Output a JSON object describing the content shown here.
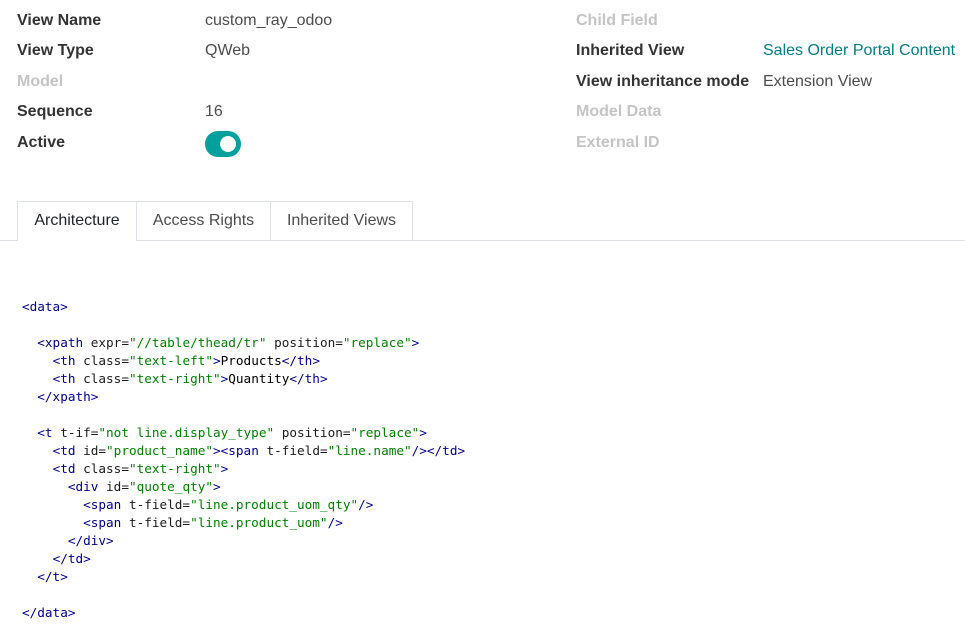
{
  "fields_left": [
    {
      "label": "View Name",
      "value": "custom_ray_odoo",
      "muted": false
    },
    {
      "label": "View Type",
      "value": "QWeb",
      "muted": false
    },
    {
      "label": "Model",
      "value": "",
      "muted": true
    },
    {
      "label": "Sequence",
      "value": "16",
      "muted": false
    },
    {
      "label": "Active",
      "toggle": true,
      "muted": false
    }
  ],
  "fields_right": [
    {
      "label": "Child Field",
      "value": "",
      "muted": true
    },
    {
      "label": "Inherited View",
      "value": "Sales Order Portal Content",
      "muted": false,
      "link": true
    },
    {
      "label": "View inheritance mode",
      "value": "Extension View",
      "muted": false
    },
    {
      "label": "Model Data",
      "value": "",
      "muted": true
    },
    {
      "label": "External ID",
      "value": "",
      "muted": true
    }
  ],
  "active_on": true,
  "tabs": [
    {
      "label": "Architecture",
      "active": true
    },
    {
      "label": "Access Rights",
      "active": false
    },
    {
      "label": "Inherited Views",
      "active": false
    }
  ],
  "code_lines": [
    "<data>",
    "",
    "  <xpath expr=\"//table/thead/tr\" position=\"replace\">",
    "    <th class=\"text-left\">Products</th>",
    "    <th class=\"text-right\">Quantity</th>",
    "  </xpath>",
    "",
    "  <t t-if=\"not line.display_type\" position=\"replace\">",
    "    <td id=\"product_name\"><span t-field=\"line.name\"/></td>",
    "    <td class=\"text-right\">",
    "      <div id=\"quote_qty\">",
    "        <span t-field=\"line.product_uom_qty\"/>",
    "        <span t-field=\"line.product_uom\"/>",
    "      </div>",
    "    </td>",
    "  </t>",
    "",
    "</data>"
  ],
  "colors": {
    "accent": "#017e84",
    "toggle": "#00a09d",
    "muted": "#c4c4c4"
  }
}
